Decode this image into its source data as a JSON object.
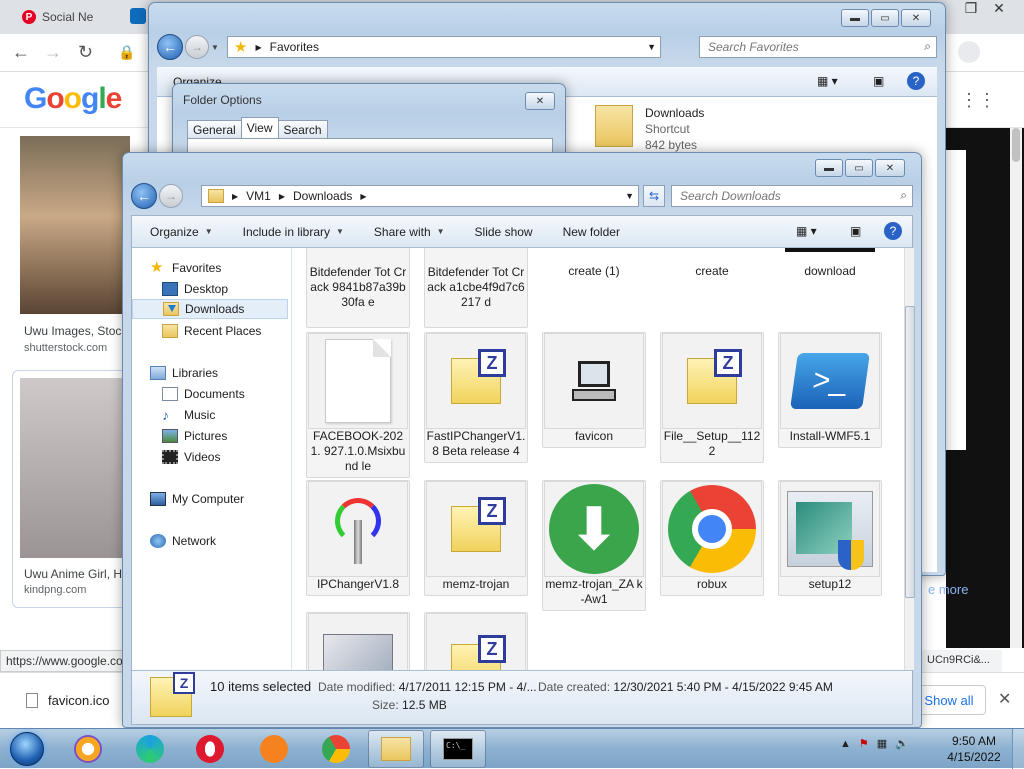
{
  "browser": {
    "tabs": [
      {
        "label": "Social Ne"
      }
    ],
    "nav": {
      "back": "←",
      "forward": "→",
      "reload": "↻"
    },
    "google_logo": [
      "G",
      "o",
      "o",
      "g",
      "l",
      "e"
    ],
    "results": [
      {
        "title": "Uwu Images, Stoc",
        "source": "shutterstock.com"
      },
      {
        "title": "Uwu Anime Girl, H",
        "source": "kindpng.com"
      }
    ],
    "see_more": "e more",
    "status_url": "https://www.google.co",
    "status_url_right": "UCn9RCi&...",
    "download_bar": {
      "file": "favicon.ico",
      "show_all": "Show all"
    }
  },
  "favorites_window": {
    "address": [
      "Favorites"
    ],
    "search_placeholder": "Search Favorites",
    "toolbar": {
      "organize": "Organize"
    },
    "item": {
      "name": "Downloads",
      "type": "Shortcut",
      "size": "842 bytes"
    }
  },
  "folder_options": {
    "title": "Folder Options",
    "tabs": [
      {
        "label": "General"
      },
      {
        "label": "View"
      },
      {
        "label": "Search"
      }
    ],
    "active_tab": "View"
  },
  "downloads_window": {
    "address": [
      "VM1",
      "Downloads"
    ],
    "search_placeholder": "Search Downloads",
    "toolbar": {
      "organize": "Organize",
      "include": "Include in library",
      "share": "Share with",
      "slideshow": "Slide show",
      "newfolder": "New folder"
    },
    "nav": {
      "favorites": "Favorites",
      "desktop": "Desktop",
      "downloads": "Downloads",
      "recent": "Recent Places",
      "libraries": "Libraries",
      "documents": "Documents",
      "music": "Music",
      "pictures": "Pictures",
      "videos": "Videos",
      "computer": "My Computer",
      "network": "Network"
    },
    "files_row0": [
      {
        "name": "Bitdefender Tot Crack 9841b87a39b30fa e"
      },
      {
        "name": "Bitdefender Tot Crack a1cbe4f9d7c6217 d"
      },
      {
        "name": "create (1)"
      },
      {
        "name": "create"
      },
      {
        "name": "download"
      }
    ],
    "files_row1": [
      {
        "name": "FACEBOOK-2021. 927.1.0.Msixbund le",
        "icon": "blank-file-icon"
      },
      {
        "name": "FastIPChangerV1. 8 Beta release 4",
        "icon": "winzip-icon"
      },
      {
        "name": "favicon",
        "icon": "computer-icon"
      },
      {
        "name": "File__Setup__1122",
        "icon": "winzip-icon"
      },
      {
        "name": "Install-WMF5.1",
        "icon": "powershell-icon"
      }
    ],
    "files_row2": [
      {
        "name": "IPChangerV1.8",
        "icon": "ip-changer-icon"
      },
      {
        "name": "memz-trojan",
        "icon": "winzip-icon"
      },
      {
        "name": "memz-trojan_ZA k-Aw1",
        "icon": "download-arrow-icon"
      },
      {
        "name": "robux",
        "icon": "chrome-icon"
      },
      {
        "name": "setup12",
        "icon": "setup-shield-icon"
      }
    ],
    "details": {
      "count": "10 items selected",
      "modified_label": "Date modified:",
      "modified_value": "4/17/2011 12:15 PM - 4/...",
      "created_label": "Date created:",
      "created_value": "12/30/2021 5:40 PM - 4/15/2022 9:45 AM",
      "size_label": "Size:",
      "size_value": "12.5 MB"
    }
  },
  "taskbar": {
    "time": "9:50 AM",
    "date": "4/15/2022",
    "cmd": "C:\\_"
  }
}
